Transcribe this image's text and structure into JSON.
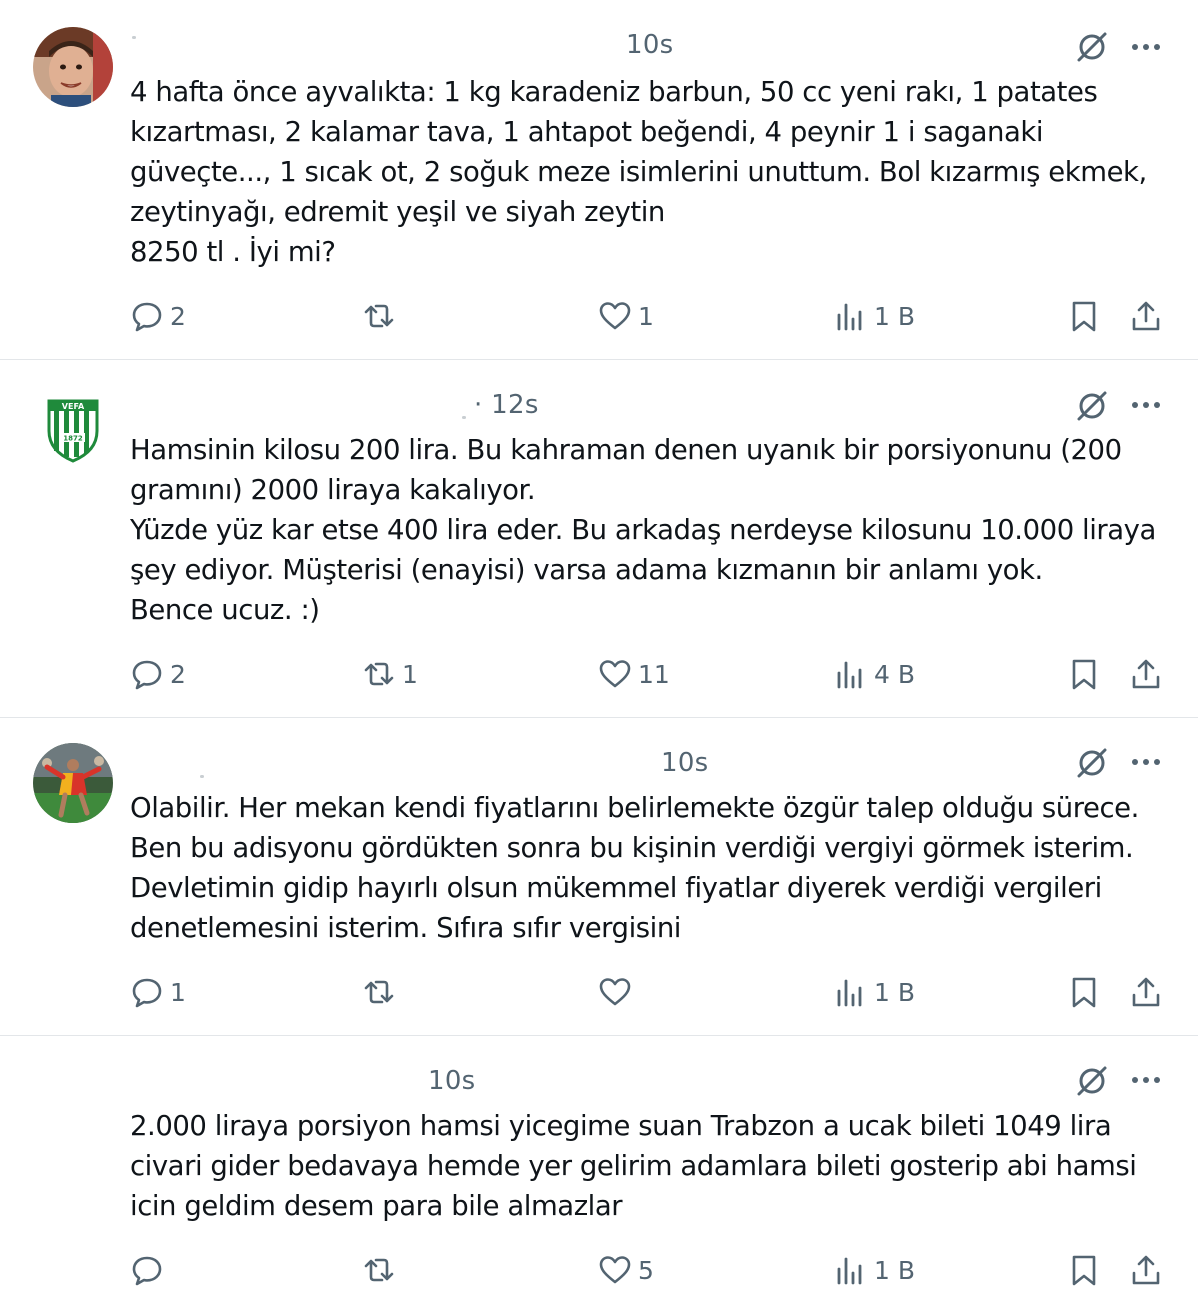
{
  "tweets": [
    {
      "time": "10s",
      "text": "4 hafta önce ayvalıkta: 1 kg karadeniz barbun, 50 cc yeni rakı, 1 patates kızartması, 2 kalamar tava, 1 ahtapot beğendi, 4 peynir 1 i saganaki güveçte..., 1 sıcak ot, 2 soğuk meze isimlerini unuttum. Bol kızarmış ekmek, zeytinyağı, edremit yeşil ve siyah zeytin\n8250 tl . İyi mi?",
      "replies": "2",
      "retweets": "",
      "likes": "1",
      "views": "1 B",
      "avatar": "person-photo"
    },
    {
      "time": "· 12s",
      "text": "Hamsinin kilosu 200 lira. Bu kahraman denen uyanık bir porsiyonunu (200 gramını)  2000 liraya kakalıyor.\nYüzde yüz kar etse 400 lira eder. Bu arkadaş nerdeyse kilosunu 10.000 liraya şey ediyor. Müşterisi (enayisi)  varsa adama kızmanın bir anlamı yok.\nBence ucuz. :)",
      "replies": "2",
      "retweets": "1",
      "likes": "11",
      "views": "4 B",
      "avatar": "vefa-logo",
      "avatar_text": {
        "top": "VEFA",
        "bottom": "1872"
      }
    },
    {
      "time": "10s",
      "text": "Olabilir. Her mekan kendi fiyatlarını belirlemekte özgür talep olduğu sürece.\nBen bu adisyonu gördükten sonra bu kişinin verdiği vergiyi görmek isterim. Devletimin gidip hayırlı olsun mükemmel fiyatlar diyerek verdiği vergileri denetlemesini isterim. Sıfıra sıfır vergisini",
      "replies": "1",
      "retweets": "",
      "likes": "",
      "views": "1 B",
      "avatar": "football-player-photo"
    },
    {
      "time": "10s",
      "text": "2.000 liraya porsiyon hamsi yicegime suan Trabzon a ucak bileti 1049 lira civari gider bedavaya hemde yer gelirim adamlara bileti gosterip abi hamsi icin geldim desem para bile almazlar",
      "replies": "",
      "retweets": "",
      "likes": "5",
      "views": "1 B",
      "avatar": ""
    }
  ],
  "colors": {
    "text": "#0f1419",
    "muted": "#536471",
    "divider": "#e3e6e9",
    "vefa_green": "#1f8a3b"
  },
  "icons": {
    "reply": "speech-bubble-icon",
    "retweet": "retweet-icon",
    "like": "heart-icon",
    "views": "bar-chart-icon",
    "bookmark": "bookmark-icon",
    "share": "share-icon",
    "grok": "grok-icon",
    "more": "more-dots-icon"
  }
}
